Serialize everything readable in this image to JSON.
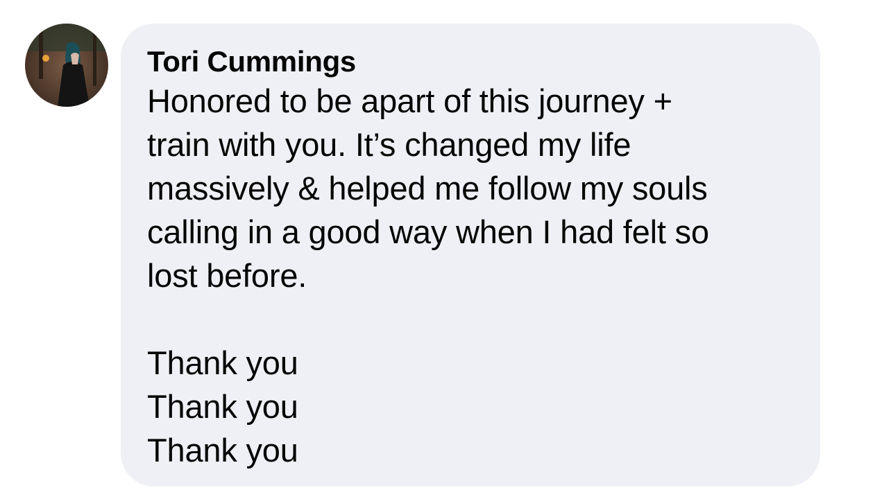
{
  "comment": {
    "author": "Tori Cummings",
    "text": "Honored to be apart of this journey +\ntrain with you. It’s changed my life\nmassively & helped me follow my souls\ncalling in a good way when I had felt so\nlost before.\n\nThank you\nThank you\nThank you"
  },
  "colors": {
    "bubble": "#eff0f5",
    "text": "#050505"
  },
  "icons": {
    "avatar": "profile-photo"
  }
}
